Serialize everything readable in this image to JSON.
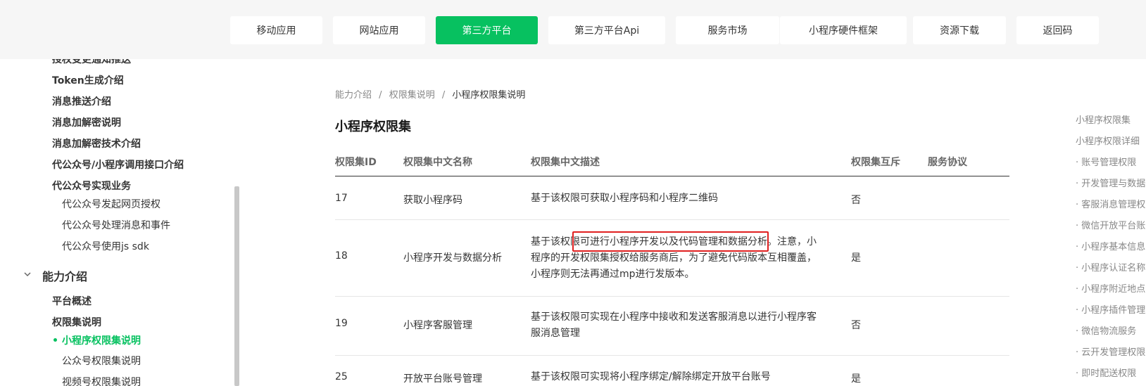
{
  "topnav": {
    "items": [
      "移动应用",
      "网站应用",
      "第三方平台",
      "第三方平台Api",
      "服务市场",
      "小程序硬件框架",
      "资源下载",
      "返回码"
    ],
    "active": "第三方平台",
    "accent_color": "#07c160"
  },
  "sidebar": {
    "partial_top": "授权变更通知推送",
    "items_before": [
      "Token生成介绍",
      "消息推送介绍",
      "消息加解密说明",
      "消息加解密技术介绍",
      "代公众号/小程序调用接口介绍",
      "代公众号实现业务"
    ],
    "sub_items": [
      "代公众号发起网页授权",
      "代公众号处理消息和事件",
      "代公众号使用js sdk"
    ],
    "section": {
      "label": "能力介绍",
      "icon": "chevron-down-icon",
      "items": [
        "平台概述",
        "权限集说明"
      ],
      "sub_items": [
        "小程序权限集说明",
        "公众号权限集说明",
        "视频号权限集说明"
      ],
      "active": "小程序权限集说明"
    }
  },
  "breadcrumb": [
    "能力介绍",
    "权限集说明",
    "小程序权限集说明"
  ],
  "breadcrumb_separator": "/",
  "page_title": "小程序权限集",
  "table": {
    "headers": [
      "权限集ID",
      "权限集中文名称",
      "权限集中文描述",
      "权限集互斥",
      "服务协议"
    ],
    "rows": [
      {
        "id": "17",
        "name": "获取小程序码",
        "desc_lines": [
          "基于该权限可获取小程序码和小程序二维码"
        ],
        "mutex": "否",
        "agreement": ""
      },
      {
        "id": "18",
        "name": "小程序开发与数据分析",
        "desc_lines": [
          "基于该权限可进行小程序开发以及代码管理和数据分析。注意，小",
          "程序的开发权限集授权给服务商后，为了避免代码版本互相覆盖，",
          "小程序则无法再通过mp进行发版本。"
        ],
        "mutex": "是",
        "agreement": ""
      },
      {
        "id": "19",
        "name": "小程序客服管理",
        "desc_lines": [
          "基于该权限可实现在小程序中接收和发送客服消息以进行小程序客",
          "服消息管理"
        ],
        "mutex": "否",
        "agreement": ""
      },
      {
        "id": "25",
        "name": "开放平台账号管理",
        "desc_lines": [
          "基于该权限可实现将小程序绑定/解除绑定开放平台账号"
        ],
        "mutex": "是",
        "agreement": ""
      }
    ],
    "highlight_color": "#e02020"
  },
  "toc": {
    "items": [
      "小程序权限集",
      "小程序权限详细",
      "· 账号管理权限",
      "· 开发管理与数据",
      "· 客服消息管理权",
      "· 微信开放平台账",
      "· 小程序基本信息",
      "· 小程序认证名称",
      "· 小程序附近地点",
      "· 小程序插件管理",
      "· 微信物流服务",
      "· 云开发管理权限",
      "· 即时配送权限"
    ]
  }
}
